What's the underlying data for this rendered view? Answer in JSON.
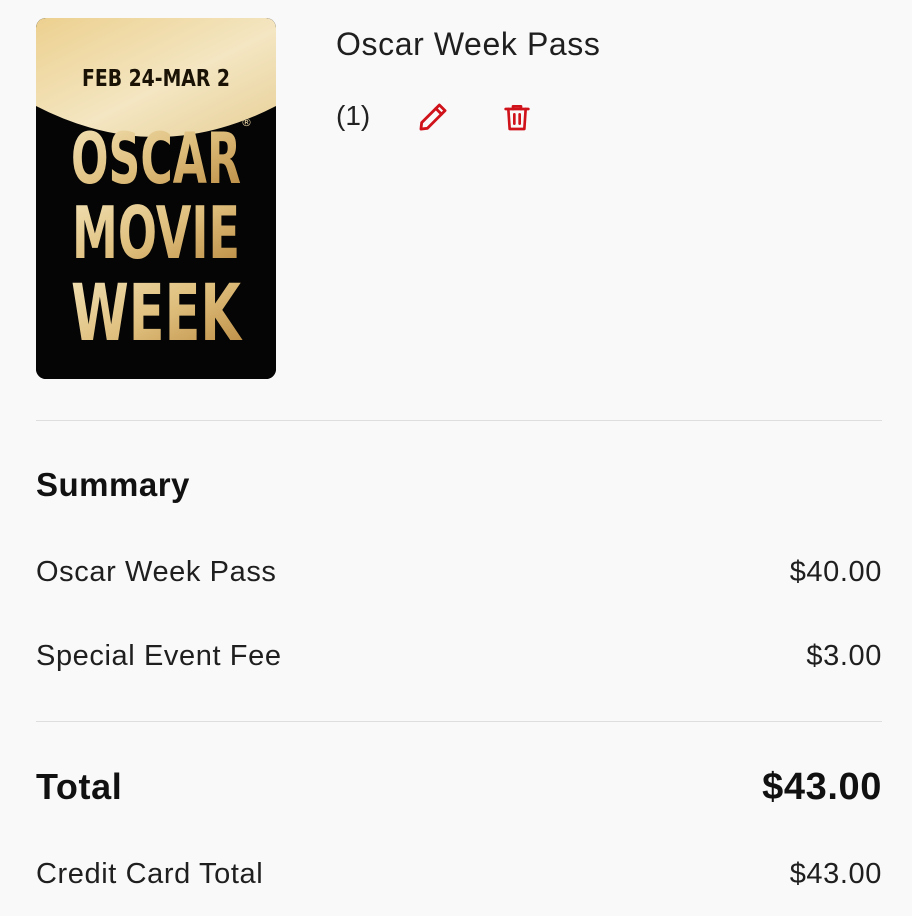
{
  "cart_item": {
    "name": "Oscar Week Pass",
    "quantity": "(1)",
    "edit_icon": "pencil-icon",
    "delete_icon": "trash-icon",
    "poster": {
      "dates": "FEB 24-MAR 2",
      "line1": "OSCAR",
      "line2": "MOVIE",
      "line3": "WEEK",
      "registered": "®"
    }
  },
  "summary": {
    "heading": "Summary",
    "lines": [
      {
        "label": "Oscar Week Pass",
        "amount": "$40.00"
      },
      {
        "label": "Special Event Fee",
        "amount": "$3.00"
      }
    ],
    "total": {
      "label": "Total",
      "amount": "$43.00"
    },
    "credit_card_total": {
      "label": "Credit Card Total",
      "amount": "$43.00"
    }
  },
  "colors": {
    "accent_red": "#d0121b",
    "gold_light": "#f1dba0",
    "gold_dark": "#c49a52",
    "background": "#f9f9fa",
    "divider": "#dedede"
  }
}
